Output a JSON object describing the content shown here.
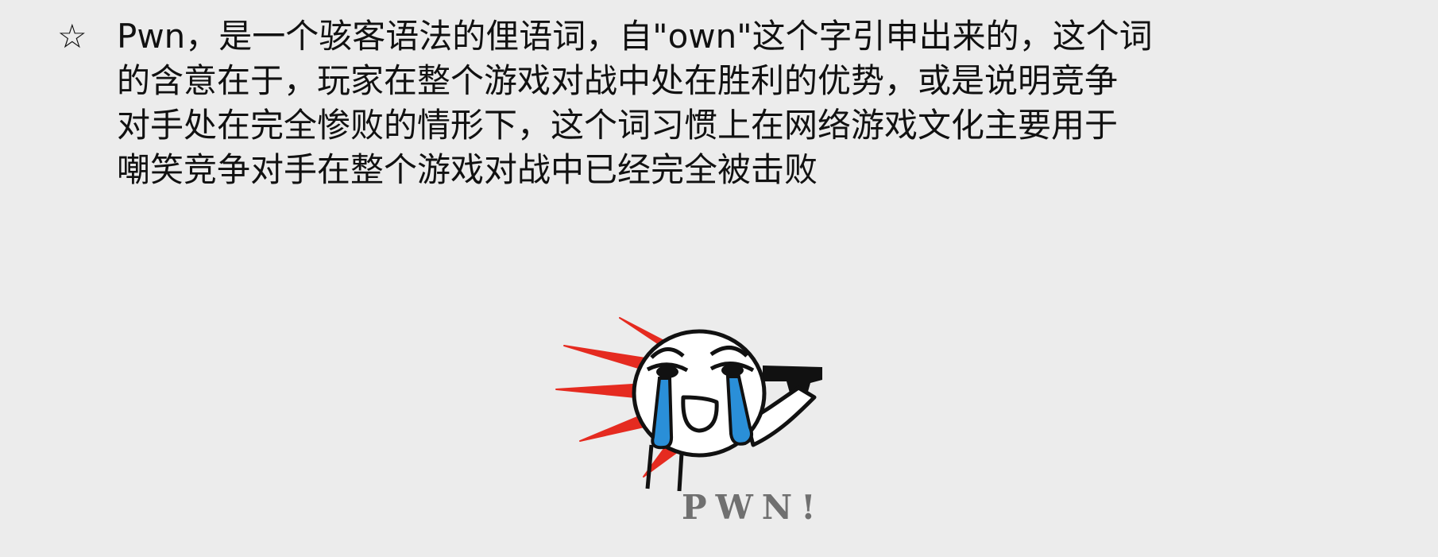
{
  "bullet": "☆",
  "lines": [
    "Pwn，是一个骇客语法的俚语词，自\"own\"这个字引申出来的，这个词",
    "的含意在于，玩家在整个游戏对战中处在胜利的优势，或是说明竞争",
    "对手处在完全惨败的情形下，这个词习惯上在网络游戏文化主要用于",
    "嘲笑竞争对手在整个游戏对战中已经完全被击败"
  ],
  "caption": "PWN!",
  "colors": {
    "background": "#ececec",
    "text": "#111111",
    "blast": "#e52b20",
    "tears": "#2a8fd8",
    "caption": "#707070"
  },
  "icons": {
    "bullet": "star-outline-icon",
    "meme": "crying-face-gun-icon"
  }
}
